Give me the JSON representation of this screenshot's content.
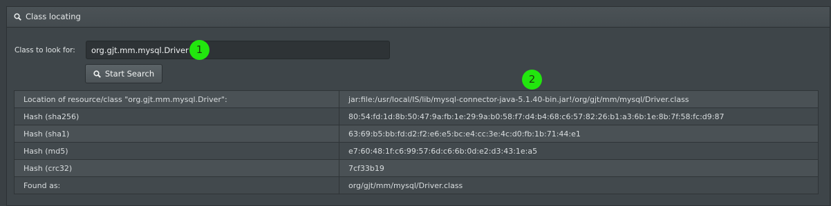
{
  "panel": {
    "title": "Class locating",
    "icon": "search-icon"
  },
  "form": {
    "label": "Class to look for:",
    "input_value": "org.gjt.mm.mysql.Driver",
    "button_label": "Start Search",
    "button_icon": "search-icon"
  },
  "badges": [
    "1",
    "2"
  ],
  "badge_color": "#22e60e",
  "results": [
    {
      "key": "Location of resource/class \"org.gjt.mm.mysql.Driver\":",
      "value": "jar:file:/usr/local/IS/lib/mysql-connector-java-5.1.40-bin.jar!/org/gjt/mm/mysql/Driver.class"
    },
    {
      "key": "Hash (sha256)",
      "value": "80:54:fd:1d:8b:50:47:9a:fb:1e:29:9a:b0:58:f7:d4:b4:68:c6:57:82:26:b1:a3:6b:1e:8b:7f:58:fc:d9:87"
    },
    {
      "key": "Hash (sha1)",
      "value": "63:69:b5:bb:fd:d2:f2:e6:e5:bc:e4:cc:3e:4c:d0:fb:1b:71:44:e1"
    },
    {
      "key": "Hash (md5)",
      "value": "e7:60:48:1f:c6:99:57:6d:c6:6b:0d:e2:d3:43:1e:a5"
    },
    {
      "key": "Hash (crc32)",
      "value": "7cf33b19"
    },
    {
      "key": "Found as:",
      "value": "org/gjt/mm/mysql/Driver.class"
    }
  ]
}
